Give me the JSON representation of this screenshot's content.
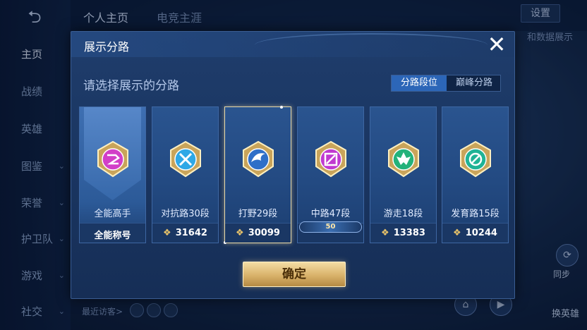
{
  "background": {
    "top_tabs": [
      "个人主页",
      "电竞主涯"
    ],
    "settings_label": "设置",
    "display_link": "和数据展示",
    "sidebar": [
      {
        "label": "主页",
        "active": true,
        "chevron": false
      },
      {
        "label": "战绩",
        "active": false,
        "chevron": false
      },
      {
        "label": "英雄",
        "active": false,
        "chevron": false
      },
      {
        "label": "图鉴",
        "active": false,
        "chevron": true
      },
      {
        "label": "荣誉",
        "active": false,
        "chevron": true
      },
      {
        "label": "护卫队",
        "active": false,
        "chevron": true
      },
      {
        "label": "游戏",
        "active": false,
        "chevron": true
      },
      {
        "label": "社交",
        "active": false,
        "chevron": true
      }
    ],
    "recent_visitors": "最近访客>",
    "right_actions": [
      "同步",
      "换英雄"
    ]
  },
  "modal": {
    "title": "展示分路",
    "prompt": "请选择展示的分路",
    "toggle": {
      "active": "分路段位",
      "inactive": "巅峰分路"
    },
    "confirm_label": "确定",
    "close_icon": "close-icon"
  },
  "cards": [
    {
      "name": "全能高手",
      "footer": "全能称号",
      "score": "",
      "selected": false,
      "rank_badge": "",
      "emblem_color": "#d23fc8",
      "banner": true
    },
    {
      "name": "对抗路30段",
      "footer": "",
      "score": "31642",
      "selected": false,
      "rank_badge": "",
      "emblem_color": "#2ea8e6",
      "banner": false
    },
    {
      "name": "打野29段",
      "footer": "",
      "score": "30099",
      "selected": true,
      "rank_badge": "",
      "emblem_color": "#2f6fc8",
      "banner": false
    },
    {
      "name": "中路47段",
      "footer": "",
      "score": "",
      "selected": false,
      "rank_badge": "50",
      "emblem_color": "#c03ad0",
      "banner": false
    },
    {
      "name": "游走18段",
      "footer": "",
      "score": "13383",
      "selected": false,
      "rank_badge": "",
      "emblem_color": "#23b27a",
      "banner": false
    },
    {
      "name": "发育路15段",
      "footer": "",
      "score": "10244",
      "selected": false,
      "rank_badge": "",
      "emblem_color": "#1fb396",
      "banner": false
    }
  ]
}
